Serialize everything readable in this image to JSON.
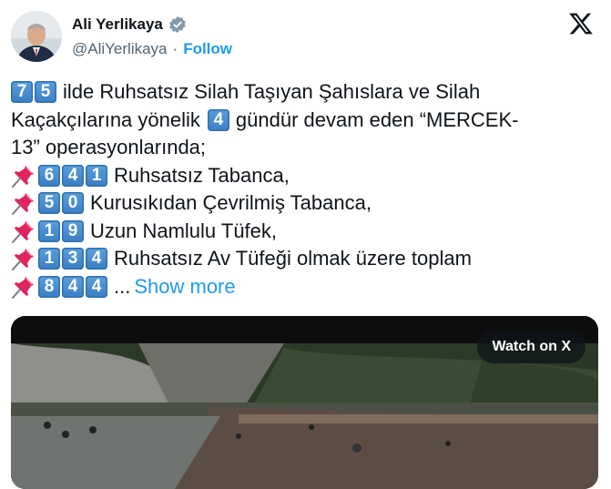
{
  "user": {
    "name": "Ali Yerlikaya",
    "handle": "@AliYerlikaya",
    "separator": "·",
    "follow_label": "Follow"
  },
  "tweet": {
    "lines": [
      {
        "pin": false,
        "keycaps": [
          "7",
          "5"
        ],
        "text": "ilde Ruhsatsız Silah Taşıyan Şahıslara ve Silah"
      },
      {
        "pin": false,
        "keycaps": [],
        "text": "Kaçakçılarına yönelik",
        "keycaps_after": [
          "4"
        ],
        "text_after": "gündür devam eden “MERCEK-"
      },
      {
        "pin": false,
        "keycaps": [],
        "text": "13” operasyonlarında;"
      },
      {
        "pin": true,
        "keycaps": [
          "6",
          "4",
          "1"
        ],
        "text": "Ruhsatsız Tabanca,"
      },
      {
        "pin": true,
        "keycaps": [
          "5",
          "0"
        ],
        "text": "Kurusıkıdan Çevrilmiş Tabanca,"
      },
      {
        "pin": true,
        "keycaps": [
          "1",
          "9"
        ],
        "text": "Uzun Namlulu Tüfek,"
      },
      {
        "pin": true,
        "keycaps": [
          "1",
          "3",
          "4"
        ],
        "text": "Ruhsatsız Av Tüfeği olmak üzere toplam"
      },
      {
        "pin": true,
        "keycaps": [
          "8",
          "4",
          "4"
        ],
        "text": "...",
        "show_more": "Show more"
      }
    ]
  },
  "media": {
    "watch_label": "Watch on X"
  },
  "icons": {
    "verified": "verified-badge-icon",
    "x_logo": "x-logo-icon",
    "pin": "pushpin-icon"
  },
  "colors": {
    "link": "#1d9bf0",
    "secondary_text": "#536471",
    "keycap": "#3a7ec4"
  }
}
